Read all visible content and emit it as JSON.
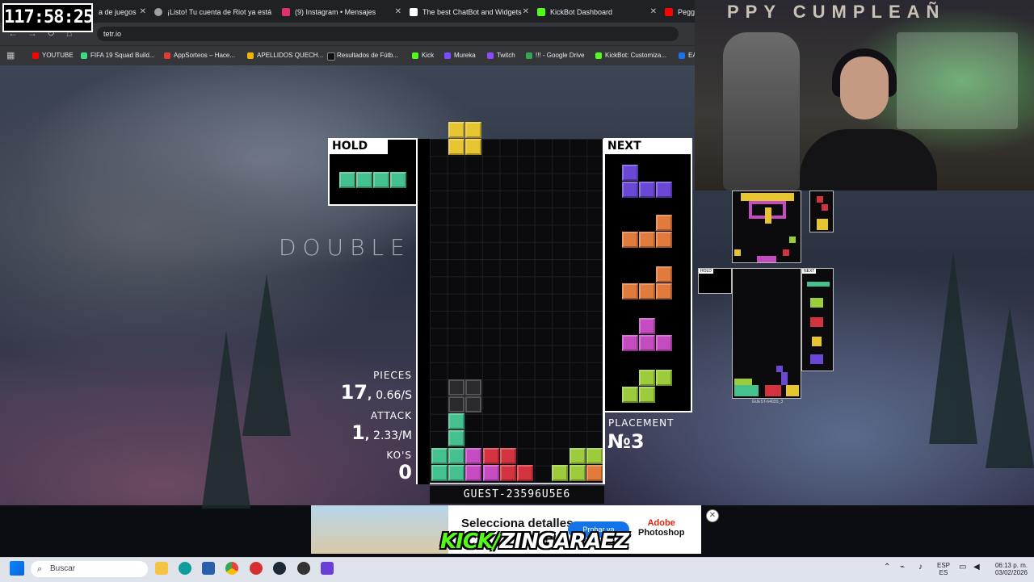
{
  "overlay": {
    "timer": "117:58:25"
  },
  "browser": {
    "tabs": [
      {
        "label": "a de juegos",
        "color": "#5f6368"
      },
      {
        "label": "¡Listo! Tu cuenta de Riot ya está",
        "color": "#9aa0a6"
      },
      {
        "label": "(9) Instagram • Mensajes",
        "color": "#e1306c"
      },
      {
        "label": "The best ChatBot and Widgets",
        "color": "#ffffff"
      },
      {
        "label": "KickBot Dashboard",
        "color": "#53fc18"
      },
      {
        "label": "Peggy",
        "color": "#ff0000"
      }
    ],
    "url": "tetr.io",
    "bookmarks": [
      {
        "label": "YOUTUBE",
        "color": "#ff0000"
      },
      {
        "label": "FIFA 19 Squad Build...",
        "color": "#3ddc84"
      },
      {
        "label": "AppSorteos – Hace...",
        "color": "#e53935"
      },
      {
        "label": "APELLIDOS QUECH...",
        "color": "#f4b400"
      },
      {
        "label": "Resultados de Fútb...",
        "color": "#222222"
      },
      {
        "label": "Kick",
        "color": "#53fc18"
      },
      {
        "label": "Mureka",
        "color": "#7c4dff"
      },
      {
        "label": "Twitch",
        "color": "#9146ff"
      },
      {
        "label": "!!! - Google Drive",
        "color": "#34a853"
      },
      {
        "label": "KickBot: Customiza...",
        "color": "#53fc18"
      },
      {
        "label": "EA",
        "color": "#1a73e8"
      }
    ]
  },
  "webcam": {
    "banner_text": "PPY  CUMPLEAÑ"
  },
  "game": {
    "hold_label": "HOLD",
    "next_label": "NEXT",
    "mode_text": "DOUBLE",
    "pieces_label": "PIECES",
    "pieces_value": "17",
    "pieces_rate": "0.66/S",
    "attack_label": "ATTACK",
    "attack_value": "1",
    "attack_rate": "2.33/M",
    "kos_label": "KO'S",
    "kos_value": "0",
    "placement_label": "PLACEMENT",
    "placement_value": "№3",
    "player_name": "GUEST-23596U5E6",
    "hold_piece": "I",
    "next_pieces": [
      "J",
      "L",
      "L",
      "T",
      "S"
    ],
    "current_piece": "O"
  },
  "opponent": {
    "hold_label": "HOLD",
    "next_label": "NEXT",
    "name": "GUEST-6403S_3"
  },
  "ad": {
    "headline": "Selecciona detalles",
    "button": "Probar ya",
    "brand_top": "Adobe",
    "brand_bottom": "Photoshop",
    "kick_a": "KICK/",
    "kick_b": "ZINGARAEZ"
  },
  "taskbar": {
    "search_placeholder": "Buscar",
    "lang_top": "ESP",
    "lang_bottom": "ES",
    "time": "06:13 p. m.",
    "date": "03/02/2026"
  }
}
